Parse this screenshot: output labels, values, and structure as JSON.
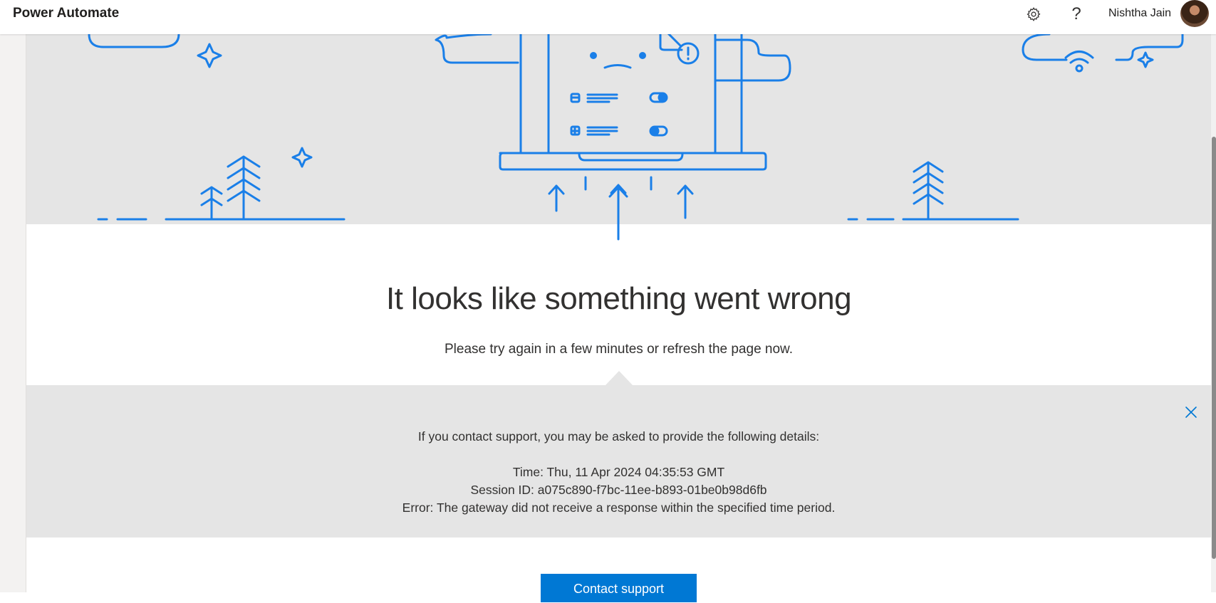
{
  "header": {
    "app_title": "Power Automate",
    "settings_icon": "gear-icon",
    "help_label": "?",
    "user_name": "Nishtha Jain"
  },
  "error": {
    "headline": "It looks like something went wrong",
    "subtext": "Please try again in a few minutes or refresh the page now."
  },
  "details": {
    "intro": "If you contact support, you may be asked to provide the following details:",
    "time": "Time: Thu, 11 Apr 2024 04:35:53 GMT",
    "session": "Session ID: a075c890-f7bc-11ee-b893-01be0b98d6fb",
    "error": "Error: The gateway did not receive a response within the specified time period."
  },
  "actions": {
    "contact_support": "Contact support"
  },
  "colors": {
    "accent": "#0078d4",
    "illustration_bg": "#e5e5e5"
  }
}
